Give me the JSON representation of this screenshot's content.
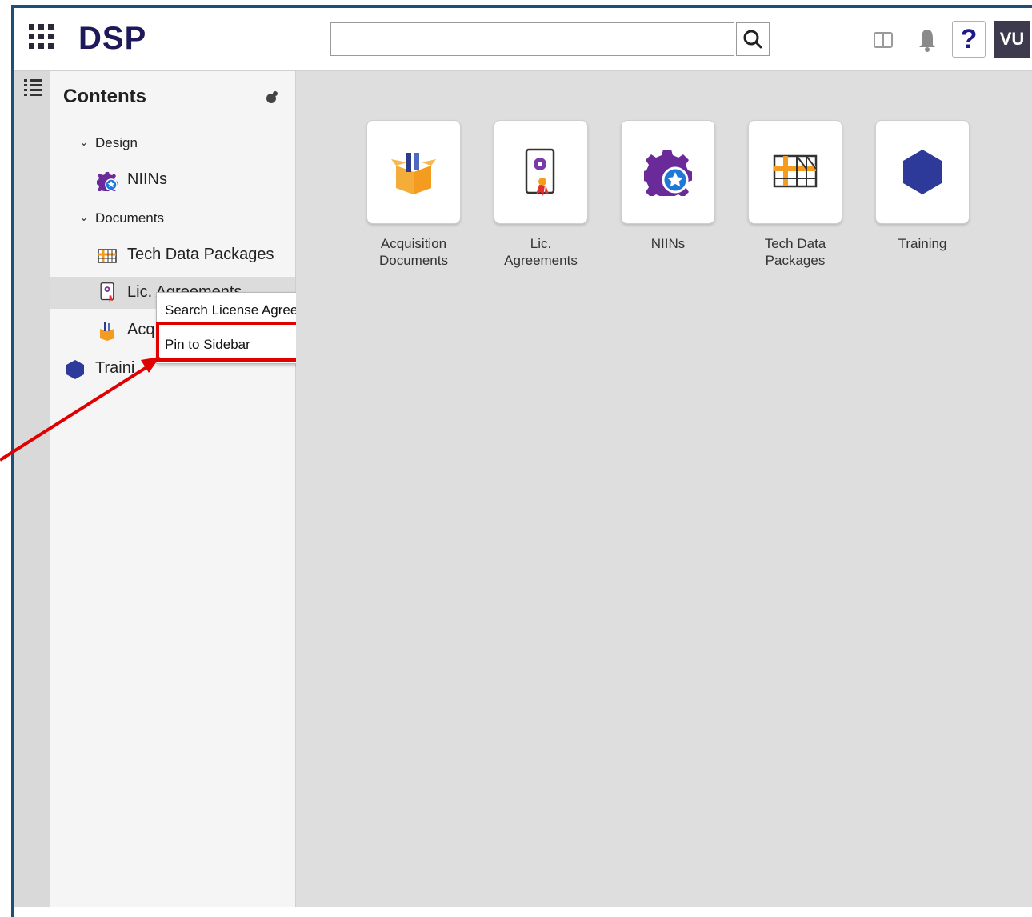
{
  "header": {
    "logo": "DSP",
    "search": {
      "value": "",
      "placeholder": ""
    },
    "help_label": "?",
    "avatar_initials": "VU"
  },
  "sidebar": {
    "title": "Contents",
    "tree": [
      {
        "label": "Design",
        "type": "group"
      },
      {
        "label": "NIINs",
        "type": "item",
        "icon": "niins-gear-icon"
      },
      {
        "label": "Documents",
        "type": "group"
      },
      {
        "label": "Tech Data Packages",
        "type": "item",
        "icon": "tech-data-icon"
      },
      {
        "label": "Lic. Agreements",
        "type": "item",
        "icon": "license-icon",
        "selected": true
      },
      {
        "label": "Acquisition Documents",
        "type": "item",
        "icon": "box-icon",
        "visible_text": "Acq"
      },
      {
        "label": "Training",
        "type": "item",
        "icon": "hexagon-icon",
        "visible_text": "Traini"
      }
    ]
  },
  "context_menu": {
    "items": [
      "Search License Agreements",
      "Pin to Sidebar"
    ],
    "highlighted": "Pin to Sidebar"
  },
  "tiles": [
    {
      "label": "Acquisition Documents",
      "icon": "box-icon"
    },
    {
      "label": "Lic. Agreements",
      "icon": "license-icon"
    },
    {
      "label": "NIINs",
      "icon": "niins-gear-icon"
    },
    {
      "label": "Tech Data Packages",
      "icon": "tech-data-icon"
    },
    {
      "label": "Training",
      "icon": "hexagon-icon"
    }
  ],
  "colors": {
    "frame": "#1f4e79",
    "logo": "#1e1a5a",
    "annotation": "#e00000",
    "hexagon": "#2e3a9a",
    "gear": "#6a2a9a",
    "orange": "#f39c20"
  }
}
